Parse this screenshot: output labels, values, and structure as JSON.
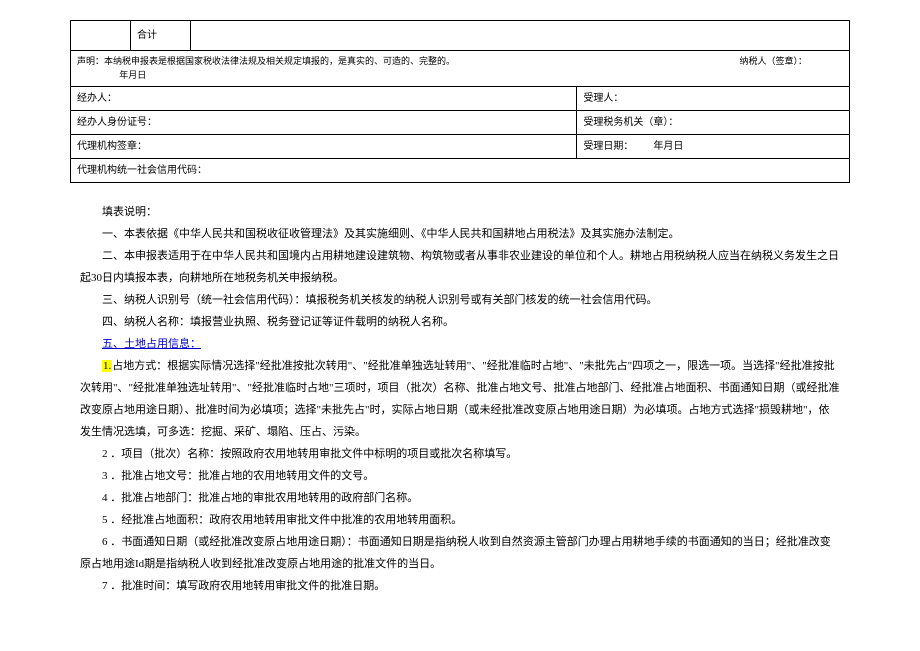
{
  "table": {
    "heji": "合计",
    "declaration": "声明：本纳税申报表是根据国家税收法律法规及相关规定填报的，是真实的、可造的、完整的。",
    "taxpayer_sig": "纳税人（签章）：",
    "date1": "年月日",
    "handler": "经办人：",
    "acceptor": "受理人：",
    "handler_id": "经办人身份证号：",
    "accept_org": "受理税务机关（章）：",
    "agent_sig": "代理机构签章：",
    "accept_date": "受理日期：",
    "date2": "年月日",
    "agent_code": "代理机构统一社会信用代码："
  },
  "instructions": {
    "title": "填表说明：",
    "item1": "一、本表依据《中华人民共和国税收征收管理法》及其实施细则、《中华人民共和国耕地占用税法》及其实施办法制定。",
    "item2": "二、本申报表适用于在中华人民共和国境内占用耕地建设建筑物、构筑物或者从事非农业建设的单位和个人。耕地占用税纳税人应当在纳税义务发生之日起30日内填报本表，向耕地所在地税务机关申报纳税。",
    "item3": "三、纳税人识别号（统一社会信用代码）：填报税务机关核发的纳税人识别号或有关部门核发的统一社会信用代码。",
    "item4": "四、纳税人名称：填报营业执照、税务登记证等证件载明的纳税人名称。",
    "item5": "五、土地占用信息：",
    "item5_1_prefix": "1.",
    "item5_1": "占地方式：根据实际情况选择\"经批准按批次转用\"、\"经批准单独选址转用\"、\"经批准临时占地\"、\"未批先占\"四项之一，限选一项。当选择\"经批准按批次转用\"、\"经批准单独选址转用\"、\"经批准临时占地\"三项时，项目（批次）名称、批准占地文号、批准占地部门、经批准占地面积、书面通知日期（或经批准改变原占地用途日期）、批准时间为必填项；选择\"未批先占\"时，实际占地日期（或未经批准改变原占地用途日期）为必填项。占地方式选择\"损毁耕地\"，依发生情况选填，可多选：挖掘、采矿、塌陷、压占、污染。",
    "item5_2": "2 ．项目（批次）名称：按照政府农用地转用审批文件中标明的项目或批次名称填写。",
    "item5_3": "3 ．批准占地文号：批准占地的农用地转用文件的文号。",
    "item5_4": "4 ．批准占地部门：批准占地的审批农用地转用的政府部门名称。",
    "item5_5": "5 ．经批准占地面积：政府农用地转用审批文件中批准的农用地转用面积。",
    "item5_6": "6 ．书面通知日期（或经批准改变原占地用途日期）：书面通知日期是指纳税人收到自然资源主管部门办理占用耕地手续的书面通知的当日；经批准改变原占地用途Id期是指纳税人收到经批准改变原占地用途的批准文件的当日。",
    "item5_7": "7 ．批准时间：填写政府农用地转用审批文件的批准日期。"
  }
}
